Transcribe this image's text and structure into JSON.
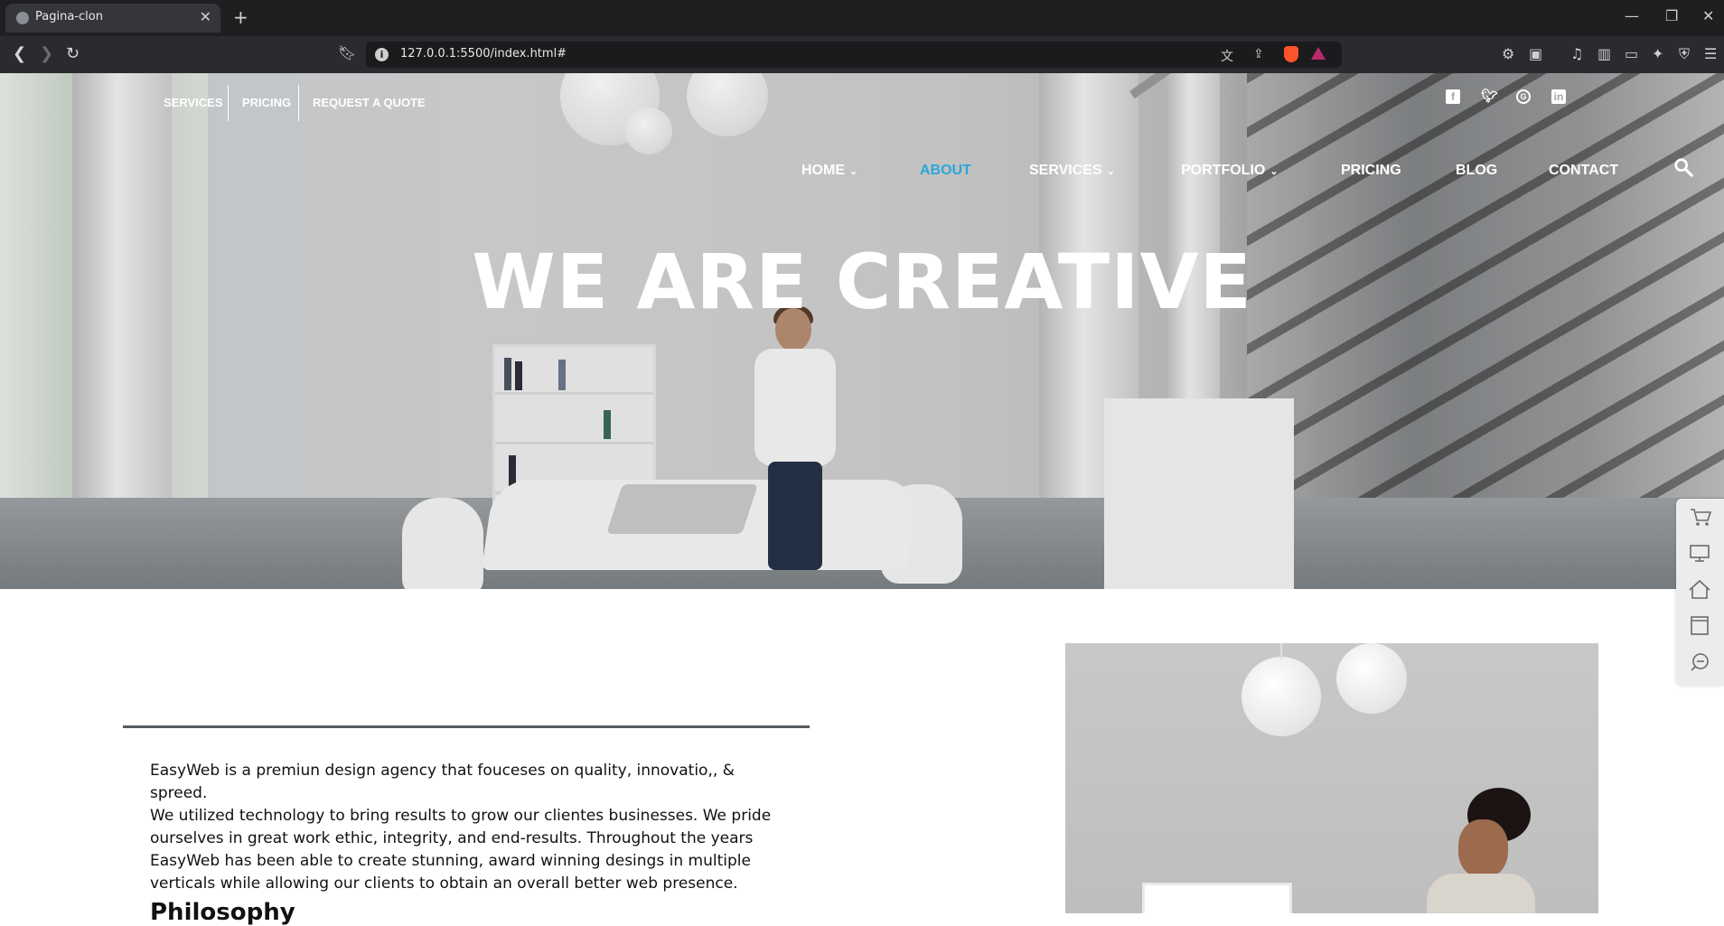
{
  "browser": {
    "tab_title": "Pagina-clon",
    "tab_close": "✕",
    "new_tab": "+",
    "url": "127.0.0.1:5500/index.html#",
    "window_controls": {
      "minimize": "—",
      "restore": "❐",
      "close": "✕"
    }
  },
  "hero": {
    "top_links": [
      "SERVICES",
      "PRICING",
      "REQUEST A QUOTE"
    ],
    "social_icons": [
      "facebook-icon",
      "twitter-icon",
      "google-plus-icon",
      "linkedin-icon"
    ],
    "nav": {
      "home": "HOME",
      "about": "ABOUT",
      "services": "SERVICES",
      "portfolio": "PORTFOLIO",
      "pricing": "PRICING",
      "blog": "BLOG",
      "contact": "CONTACT"
    },
    "active_nav": "ABOUT",
    "title": "WE ARE CREATIVE"
  },
  "side_dock": [
    "cart-icon",
    "monitor-icon",
    "home-icon",
    "archive-icon",
    "support-icon"
  ],
  "about": {
    "paragraph_lines": [
      "EasyWeb is a premiun design agency that fouceses on quality, innovatio,, & spreed.",
      "We utilized technology to bring results to grow our clientes businesses. We pride",
      "ourselves in great work ethic, integrity, and end-results. Throughout the years",
      "EasyWeb has been able to create stunning, award winning desings in multiple",
      "verticals while allowing our clients to obtain an overall better web presence."
    ],
    "heading": "Philosophy"
  },
  "colors": {
    "accent": "#2aa7d8",
    "browser_bg": "#1f1f22",
    "toolbar_bg": "#2b2b2f",
    "rule": "#555a5e"
  }
}
